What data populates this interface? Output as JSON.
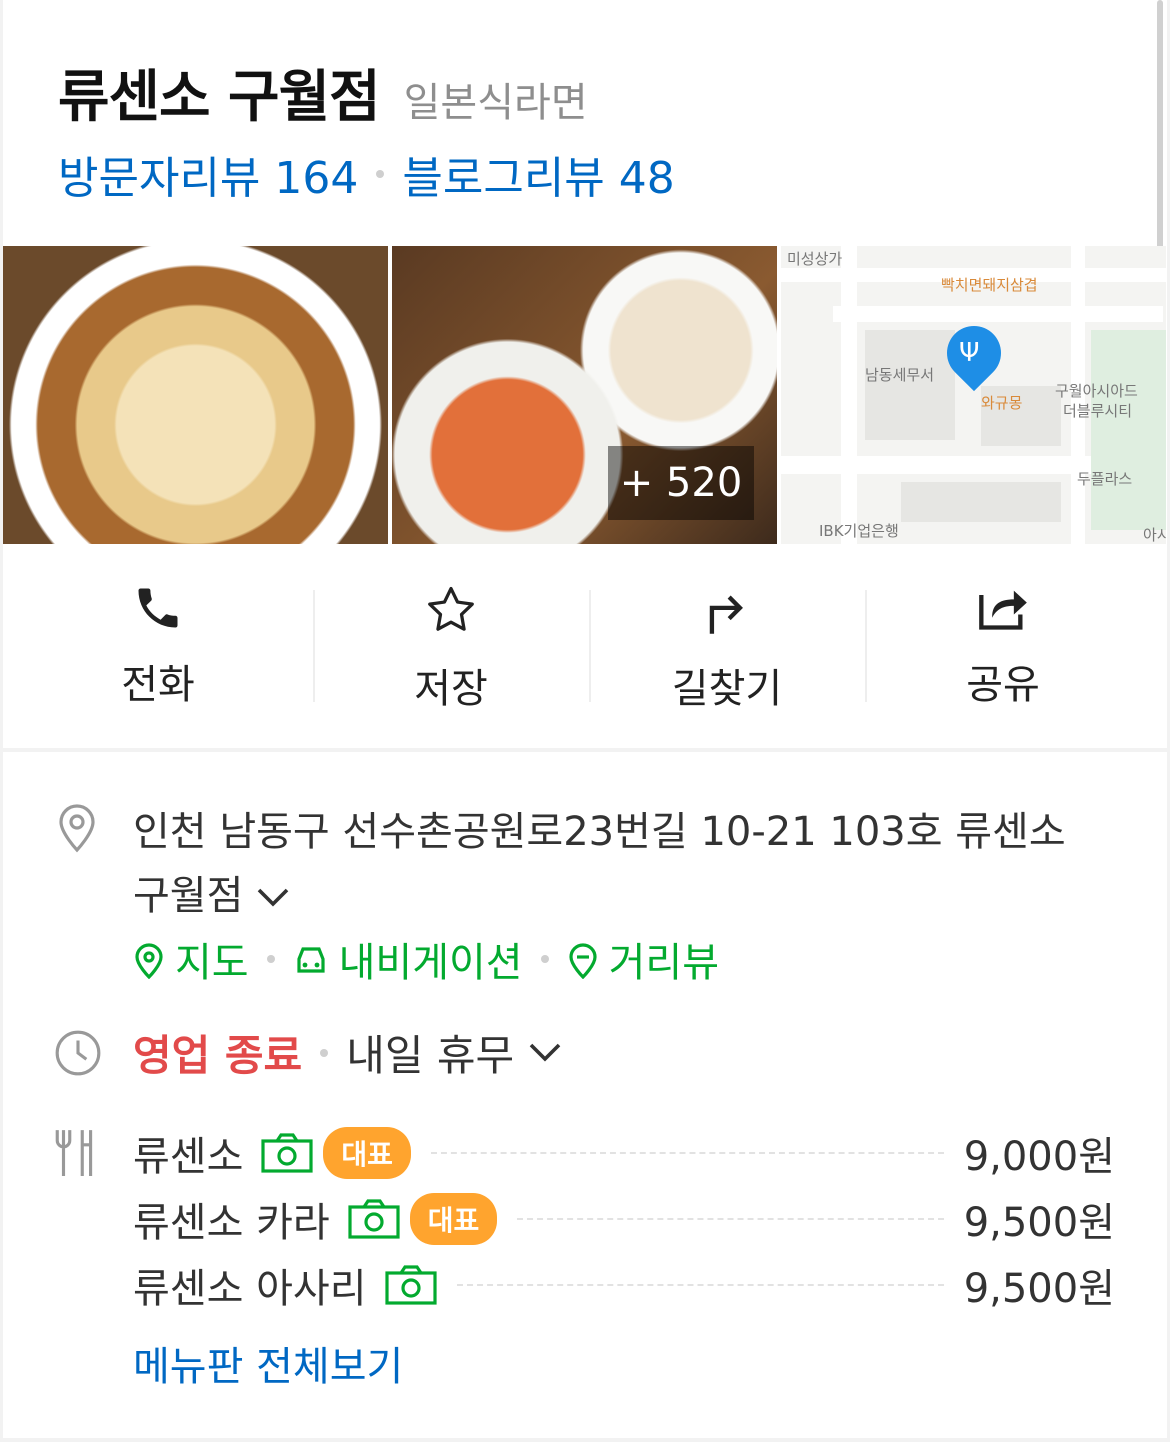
{
  "place": {
    "title": "류센소 구월점",
    "category": "일본식라면",
    "visitor_reviews": "방문자리뷰 164",
    "blog_reviews": "블로그리뷰 48"
  },
  "photos": {
    "more_count": "+ 520"
  },
  "map": {
    "labels": [
      "미성상가",
      "빡치면돼지삼겹",
      "남동세무서",
      "와규몽",
      "구월아시아드",
      "더블루시티",
      "두플라스",
      "IBK기업은행",
      "아시"
    ]
  },
  "actions": [
    {
      "label": "전화",
      "icon": "phone-icon"
    },
    {
      "label": "저장",
      "icon": "star-icon"
    },
    {
      "label": "길찾기",
      "icon": "directions-icon"
    },
    {
      "label": "공유",
      "icon": "share-icon"
    }
  ],
  "address": {
    "text": "인천 남동구 선수촌공원로23번길 10-21 103호 류센소 구월점",
    "links": [
      "지도",
      "내비게이션",
      "거리뷰"
    ]
  },
  "hours": {
    "status": "영업 종료",
    "next": "내일 휴무"
  },
  "menu": {
    "items": [
      {
        "name": "류센소",
        "badge": "대표",
        "price": "9,000원"
      },
      {
        "name": "류센소 카라",
        "badge": "대표",
        "price": "9,500원"
      },
      {
        "name": "류센소 아사리",
        "badge": "",
        "price": "9,500원"
      }
    ],
    "view_all": "메뉴판 전체보기"
  },
  "colors": {
    "link_blue": "#0068c3",
    "green": "#03aa2f",
    "closed_red": "#e24a4a",
    "badge_orange": "#ffa42e"
  }
}
